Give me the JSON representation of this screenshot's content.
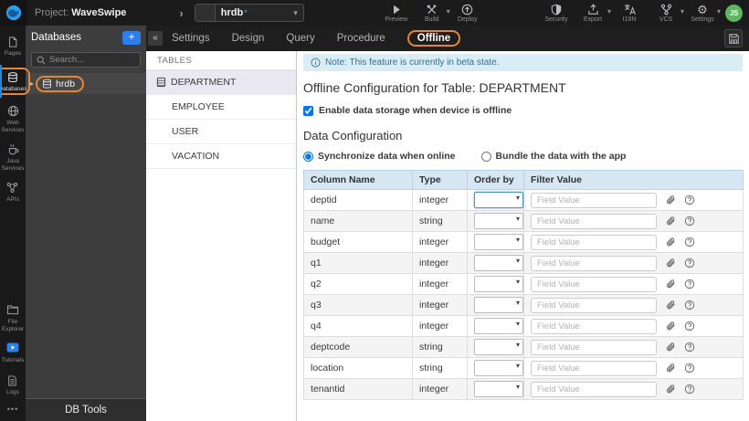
{
  "topbar": {
    "project_label": "Project:",
    "project_name": "WaveSwipe",
    "db_selector": {
      "value": "hrdb",
      "modified_indicator": "*"
    },
    "actions": [
      {
        "label": "Preview",
        "icon": "play",
        "has_caret": false
      },
      {
        "label": "Build",
        "icon": "build",
        "has_caret": true
      },
      {
        "label": "Deploy",
        "icon": "deploy",
        "has_caret": false
      }
    ],
    "tools": [
      {
        "label": "Security",
        "icon": "shield",
        "has_caret": false
      },
      {
        "label": "Export",
        "icon": "export",
        "has_caret": true
      },
      {
        "label": "I18N",
        "icon": "i18n",
        "has_caret": false
      },
      {
        "label": "VCS",
        "icon": "vcs",
        "has_caret": true
      },
      {
        "label": "Settings",
        "icon": "gear",
        "has_caret": true
      }
    ],
    "avatar_initials": "JS"
  },
  "sidebar": {
    "top_items": [
      {
        "label": "Pages",
        "icon": "pages",
        "active": false,
        "highlighted": false
      },
      {
        "label": "Databases",
        "icon": "db",
        "active": true,
        "highlighted": true
      },
      {
        "label": "Web Services",
        "icon": "globe",
        "active": false,
        "highlighted": false
      },
      {
        "label": "Java Services",
        "icon": "coffee",
        "active": false,
        "highlighted": false
      },
      {
        "label": "APIs",
        "icon": "api",
        "active": false,
        "highlighted": false
      }
    ],
    "bottom_items": [
      {
        "label": "File Explorer",
        "icon": "folder",
        "active": false,
        "highlighted": false
      },
      {
        "label": "Tutorials",
        "icon": "tutorial",
        "active": false,
        "highlighted": false
      },
      {
        "label": "Logs",
        "icon": "logs",
        "active": false,
        "highlighted": false
      }
    ],
    "more_label": "•••"
  },
  "db_panel": {
    "title": "Databases",
    "add_button_label": "+",
    "search_placeholder": "Search...",
    "items": [
      {
        "label": "hrdb",
        "highlighted": true,
        "expand_caret": "▸"
      }
    ],
    "footer_label": "DB Tools"
  },
  "tabbar": {
    "collapse_glyph": "«",
    "tabs": [
      {
        "label": "Settings",
        "active": false
      },
      {
        "label": "Design",
        "active": false
      },
      {
        "label": "Query",
        "active": false
      },
      {
        "label": "Procedure",
        "active": false
      },
      {
        "label": "Offline",
        "active": true
      }
    ]
  },
  "tables_panel": {
    "title": "TABLES",
    "items": [
      {
        "label": "DEPARTMENT",
        "selected": true
      },
      {
        "label": "EMPLOYEE",
        "selected": false
      },
      {
        "label": "USER",
        "selected": false
      },
      {
        "label": "VACATION",
        "selected": false
      }
    ]
  },
  "main": {
    "note_text": "Note: This feature is currently in beta state.",
    "title": "Offline Configuration for Table: DEPARTMENT",
    "enable_checkbox": {
      "label": "Enable data storage when device is offline",
      "checked": true
    },
    "section_title": "Data Configuration",
    "radios": [
      {
        "label": "Synchronize data when online",
        "selected": true
      },
      {
        "label": "Bundle the data with the app",
        "selected": false
      }
    ],
    "table": {
      "headers": [
        "Column Name",
        "Type",
        "Order by",
        "Filter Value"
      ],
      "filter_placeholder": "Field Value",
      "order_by_selected_value": "",
      "focused_row_index": 0,
      "rows": [
        {
          "column": "deptid",
          "type": "integer"
        },
        {
          "column": "name",
          "type": "string"
        },
        {
          "column": "budget",
          "type": "integer"
        },
        {
          "column": "q1",
          "type": "integer"
        },
        {
          "column": "q2",
          "type": "integer"
        },
        {
          "column": "q3",
          "type": "integer"
        },
        {
          "column": "q4",
          "type": "integer"
        },
        {
          "column": "deptcode",
          "type": "string"
        },
        {
          "column": "location",
          "type": "string"
        },
        {
          "column": "tenantid",
          "type": "integer"
        }
      ]
    }
  },
  "colors": {
    "highlight_orange": "#e8862d",
    "note_bg": "#d9edf7",
    "note_text": "#31708f",
    "table_header_bg": "#d6e6f3",
    "brand_blue": "#2d7ff0",
    "avatar_green": "#5cb85c",
    "focus_blue": "#4a90d9",
    "selected_table_row_bg": "#e9e7f1"
  }
}
